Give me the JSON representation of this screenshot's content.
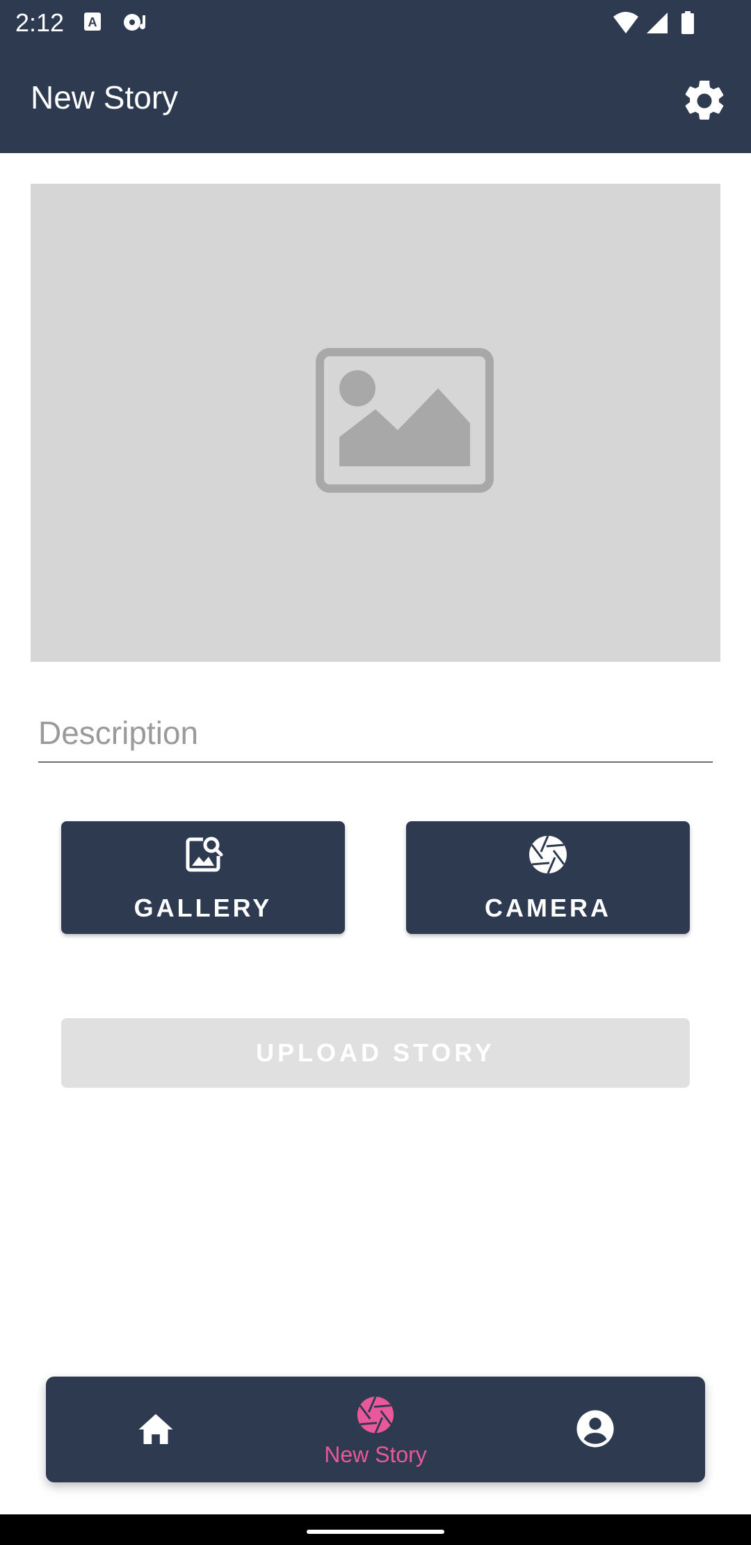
{
  "status_bar": {
    "time": "2:12",
    "icons": [
      "text-a-icon",
      "media-icon",
      "wifi-icon",
      "signal-icon",
      "battery-icon"
    ]
  },
  "app_bar": {
    "title": "New Story",
    "settings_icon": "gear-icon"
  },
  "image_preview": {
    "placeholder_icon": "image-icon"
  },
  "description": {
    "placeholder": "Description",
    "value": ""
  },
  "buttons": {
    "gallery": {
      "label": "GALLERY",
      "icon": "image-search-icon"
    },
    "camera": {
      "label": "CAMERA",
      "icon": "camera-shutter-icon"
    },
    "upload": {
      "label": "UPLOAD STORY",
      "enabled": false
    }
  },
  "bottom_nav": {
    "items": [
      {
        "id": "home",
        "icon": "home-icon",
        "label": "",
        "active": false
      },
      {
        "id": "new-story",
        "icon": "camera-shutter-icon",
        "label": "New Story",
        "active": true
      },
      {
        "id": "profile",
        "icon": "account-icon",
        "label": "",
        "active": false
      }
    ]
  },
  "colors": {
    "primary": "#2e3a4f",
    "accent": "#e8589a",
    "preview_bg": "#d6d6d6",
    "disabled": "#e0e0e0"
  }
}
